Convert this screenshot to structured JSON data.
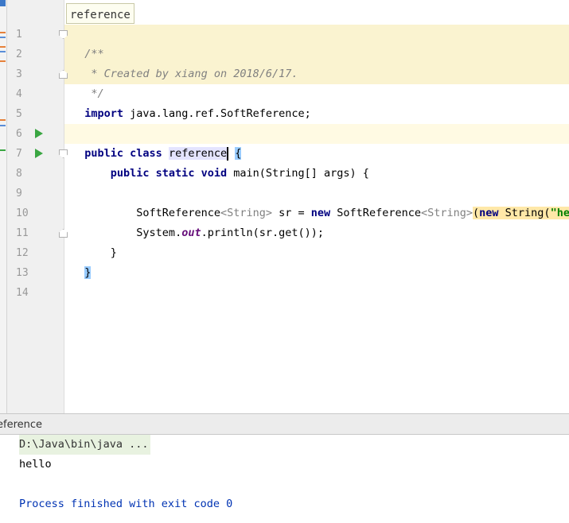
{
  "editor_tab": {
    "label": "reference"
  },
  "line_numbers": [
    "1",
    "2",
    "3",
    "4",
    "5",
    "6",
    "7",
    "8",
    "9",
    "10",
    "11",
    "12",
    "13",
    "14"
  ],
  "code": {
    "l1": "/**",
    "l2": " * Created by xiang on 2018/6/17.",
    "l3": " */",
    "l4_kw": "import",
    "l4_rest": " java.lang.ref.SoftReference;",
    "l6_kw": "public class",
    "l6_sp": " ",
    "l6_name": "reference",
    "l6_brace": "{",
    "l7_indent": "    ",
    "l7_kw": "public static void",
    "l7_rest": " main(String[] args) {",
    "l9_indent": "        ",
    "l9_a": "SoftReference",
    "l9_gen1": "<String>",
    "l9_b": " sr = ",
    "l9_kw": "new",
    "l9_c": " SoftReference",
    "l9_gen2": "<String>",
    "l9_paren": "(",
    "l9_kw2": "new",
    "l9_d": " String(",
    "l9_str": "\"hell",
    "l10_indent": "        ",
    "l10_a": "System.",
    "l10_field": "out",
    "l10_b": ".println(sr.get());",
    "l11": "    }",
    "l12": "}"
  },
  "run_panel": {
    "title": "eference",
    "command": "D:\\Java\\bin\\java ...",
    "output": "hello",
    "exit_message": "Process finished with exit code 0"
  },
  "colors": {
    "keyword": "#000080",
    "comment": "#808080",
    "string": "#008000",
    "field": "#660e7a",
    "comment_bg": "#faf3d0",
    "caret_line_bg": "#fffae3",
    "console_info": "#0033b3"
  },
  "icons": [
    "run-gutter-icon",
    "fold-marker-icon"
  ]
}
